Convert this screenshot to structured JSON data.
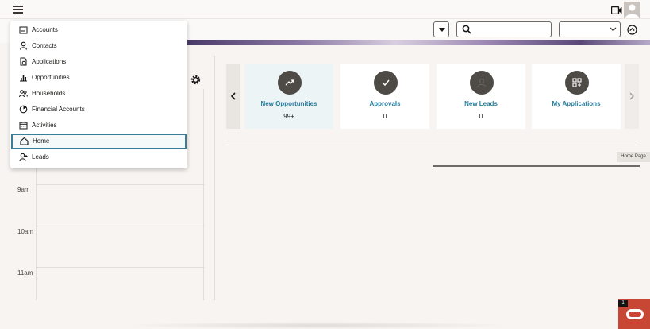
{
  "menu": {
    "items": [
      {
        "label": "Accounts",
        "icon": "accounts-icon"
      },
      {
        "label": "Contacts",
        "icon": "contacts-icon"
      },
      {
        "label": "Applications",
        "icon": "applications-icon"
      },
      {
        "label": "Opportunities",
        "icon": "opportunities-icon"
      },
      {
        "label": "Households",
        "icon": "households-icon"
      },
      {
        "label": "Financial Accounts",
        "icon": "financial-accounts-icon"
      },
      {
        "label": "Activities",
        "icon": "activities-icon"
      },
      {
        "label": "Home",
        "icon": "home-icon",
        "selected": true
      },
      {
        "label": "Leads",
        "icon": "leads-icon"
      }
    ]
  },
  "calendar": {
    "hours": [
      "9am",
      "10am",
      "11am"
    ]
  },
  "cards": [
    {
      "title": "New Opportunities",
      "count": "99+",
      "icon": "trend-up-icon"
    },
    {
      "title": "Approvals",
      "count": "0",
      "icon": "checkmark-icon"
    },
    {
      "title": "New Leads",
      "count": "0",
      "icon": "lead-icon"
    },
    {
      "title": "My Applications",
      "count": "",
      "icon": "apps-grid-icon"
    }
  ],
  "tooltip": "Home Page",
  "badge": {
    "count": "1"
  },
  "colors": {
    "accent": "#227e9e",
    "selected_border": "#3b7d99",
    "brand": "#c74634"
  }
}
